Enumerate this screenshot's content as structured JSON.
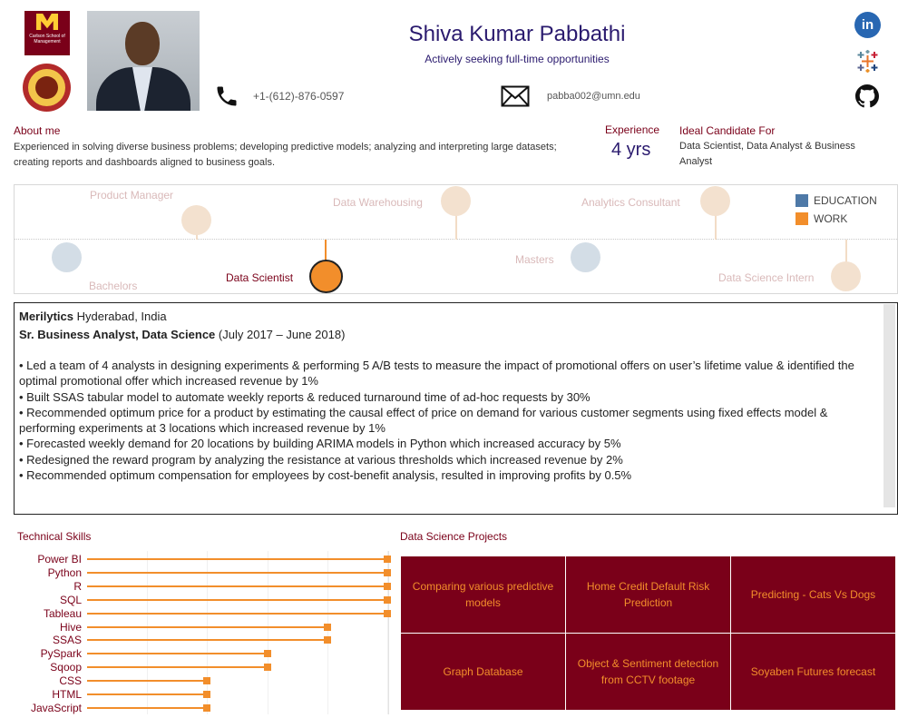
{
  "header": {
    "logo_top": "Carlson School of Management",
    "name": "Shiva Kumar Pabbathi",
    "tagline": "Actively seeking full-time opportunities",
    "phone": "+1-(612)-876-0597",
    "email": "pabba002@umn.edu",
    "social": {
      "linkedin": "in"
    },
    "icons": [
      "phone-icon",
      "mail-icon",
      "linkedin-icon",
      "tableau-icon",
      "github-icon"
    ]
  },
  "about": {
    "title": "About me",
    "text": "Experienced in solving diverse business problems; developing predictive models; analyzing and interpreting large datasets; creating reports and dashboards aligned to business goals."
  },
  "experience": {
    "title": "Experience",
    "value": "4 yrs"
  },
  "ideal": {
    "title": "Ideal Candidate For",
    "text": "Data Scientist,  Data Analyst & Business Analyst"
  },
  "timeline": {
    "legend": [
      {
        "label": "EDUCATION",
        "color": "#4e79a7"
      },
      {
        "label": "WORK",
        "color": "#f28e2b"
      }
    ],
    "events": [
      {
        "label": "Product Manager",
        "type": "work"
      },
      {
        "label": "Data Warehousing",
        "type": "work"
      },
      {
        "label": "Analytics Consultant",
        "type": "work"
      },
      {
        "label": "Bachelors",
        "type": "education"
      },
      {
        "label": "Data Scientist",
        "type": "work",
        "selected": true
      },
      {
        "label": "Masters",
        "type": "education"
      },
      {
        "label": "Data Science Intern",
        "type": "work"
      }
    ]
  },
  "detail": {
    "company": "Merilytics",
    "location": "Hyderabad, India",
    "role": "Sr. Business Analyst, Data Science",
    "period": "(July 2017 – June 2018)",
    "bullets": [
      "• Led a team of 4 analysts in designing experiments & performing 5 A/B tests to measure the impact of promotional offers on user’s lifetime value & identified the optimal promotional offer which increased revenue by 1%",
      "• Built SSAS tabular model to automate weekly reports & reduced turnaround time of ad-hoc requests by 30%",
      "• Recommended optimum price for a product by estimating the causal effect of price on demand for various customer segments using fixed effects model & performing experiments at 3 locations which increased revenue by 1%",
      "• Forecasted weekly demand for 20 locations by building ARIMA models in Python which increased accuracy by 5%",
      "• Redesigned the reward program by analyzing the resistance at various thresholds which increased revenue by 2%",
      "• Recommended optimum compensation for employees by cost-benefit analysis, resulted in improving profits by 0.5%"
    ]
  },
  "skills": {
    "title": "Technical Skills",
    "items": [
      {
        "name": "Power BI",
        "level": 5
      },
      {
        "name": "Python",
        "level": 5
      },
      {
        "name": "R",
        "level": 5
      },
      {
        "name": "SQL",
        "level": 5
      },
      {
        "name": "Tableau",
        "level": 5
      },
      {
        "name": "Hive",
        "level": 4
      },
      {
        "name": "SSAS",
        "level": 4
      },
      {
        "name": "PySpark",
        "level": 3
      },
      {
        "name": "Sqoop",
        "level": 3
      },
      {
        "name": "CSS",
        "level": 2
      },
      {
        "name": "HTML",
        "level": 2
      },
      {
        "name": "JavaScript",
        "level": 2
      }
    ],
    "max_level": 5
  },
  "projects": {
    "title": "Data Science Projects",
    "items": [
      "Comparing various predictive models",
      "Home Credit Default Risk Prediction",
      "Predicting - Cats Vs Dogs",
      "Graph Database",
      "Object & Sentiment detection from CCTV footage",
      "Soyaben Futures forecast"
    ]
  },
  "colors": {
    "accent": "#7a0019",
    "work": "#f28e2b",
    "education": "#4e79a7",
    "name": "#2a1a6e"
  }
}
